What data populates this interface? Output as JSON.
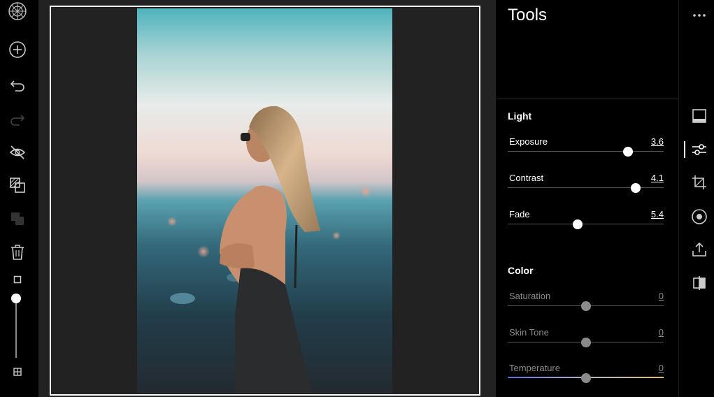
{
  "left_toolbar": {
    "icons": [
      "vsco-logo-icon",
      "add-icon",
      "undo-icon",
      "redo-icon",
      "hide-icon",
      "compare-icon",
      "copy-icon",
      "trash-icon",
      "square-icon",
      "zoom-slider",
      "grid-icon"
    ]
  },
  "canvas": {
    "photo_description_icon": "photo-image"
  },
  "tools_panel": {
    "title": "Tools",
    "light": {
      "title": "Light",
      "adjustments": [
        {
          "label": "Exposure",
          "value": "3.6",
          "level": 0.77
        },
        {
          "label": "Contrast",
          "value": "4.1",
          "level": 0.82
        },
        {
          "label": "Fade",
          "value": "5.4",
          "level": 0.45
        }
      ]
    },
    "color": {
      "title": "Color",
      "adjustments": [
        {
          "label": "Saturation",
          "value": "0",
          "level": 0.5
        },
        {
          "label": "Skin Tone",
          "value": "0",
          "level": 0.5
        },
        {
          "label": "Temperature",
          "value": "0",
          "level": 0.5
        }
      ]
    }
  },
  "right_tabs": [
    "more-icon",
    "frame-icon",
    "sliders-icon",
    "crop-icon",
    "effects-icon",
    "export-icon",
    "split-icon"
  ],
  "colors": {
    "background": "#000000",
    "canvas": "#222222",
    "accent": "#ffffff"
  }
}
